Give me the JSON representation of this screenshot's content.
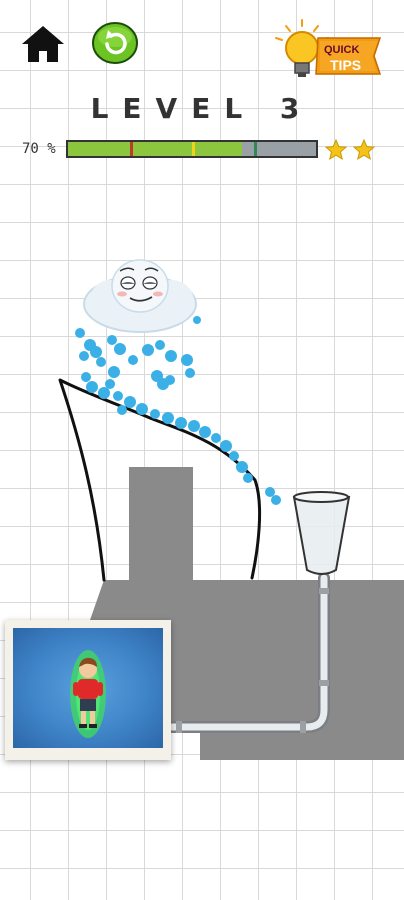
{
  "level": {
    "title": "LEVEL 3"
  },
  "progress": {
    "label": "70 %",
    "fraction": 0.7,
    "stars_earned": 2
  },
  "tips": {
    "line1": "QUICK",
    "line2": "TIPS"
  },
  "icons": {
    "home": "home-icon",
    "restart": "restart-icon",
    "tips": "lightbulb-icon",
    "star": "star-icon"
  },
  "colors": {
    "progress_fill": "#8cc63f",
    "progress_track": "#9aa1a6",
    "marker_red": "#c0392b",
    "marker_yellow": "#f1d21a",
    "marker_green": "#2e8b57",
    "star": "#f4c21a",
    "water": "#3bb0e6",
    "block": "#8a8a8a",
    "restart": "#6cc324",
    "tips_badge": "#f39c12"
  }
}
